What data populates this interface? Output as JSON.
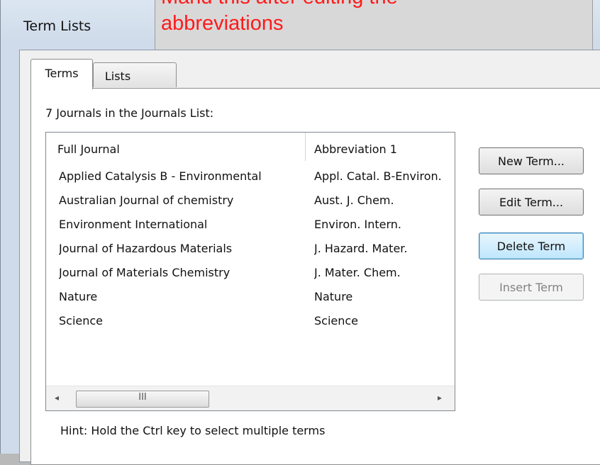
{
  "window": {
    "title": "Term Lists"
  },
  "callout": {
    "line1": "Mand this after editing the",
    "line2": "abbreviations"
  },
  "tabs": [
    {
      "label": "Terms",
      "active": true
    },
    {
      "label": "Lists",
      "active": false
    }
  ],
  "list": {
    "count_label": "7 Journals in the Journals List:",
    "columns": [
      "Full Journal",
      "Abbreviation 1"
    ],
    "rows": [
      {
        "full": "Applied Catalysis B - Environmental",
        "abbr": "Appl. Catal. B-Environ."
      },
      {
        "full": "Australian Journal of chemistry",
        "abbr": "Aust. J. Chem."
      },
      {
        "full": "Environment International",
        "abbr": "Environ. Intern."
      },
      {
        "full": "Journal of Hazardous Materials",
        "abbr": "J. Hazard. Mater."
      },
      {
        "full": "Journal of Materials Chemistry",
        "abbr": "J. Mater. Chem."
      },
      {
        "full": "Nature",
        "abbr": "Nature"
      },
      {
        "full": "Science",
        "abbr": "Science"
      }
    ]
  },
  "buttons": {
    "new_term": "New Term...",
    "edit_term": "Edit Term...",
    "delete_term": "Delete Term",
    "insert_term": "Insert Term"
  },
  "scrollbar": {
    "thumb_grip": "III",
    "left_arrow": "◂",
    "right_arrow": "▸"
  },
  "hint": "Hint: Hold the Ctrl key to select multiple terms",
  "colors": {
    "callout_text": "#ff1a1a",
    "focus_button": "#bee6fd"
  }
}
